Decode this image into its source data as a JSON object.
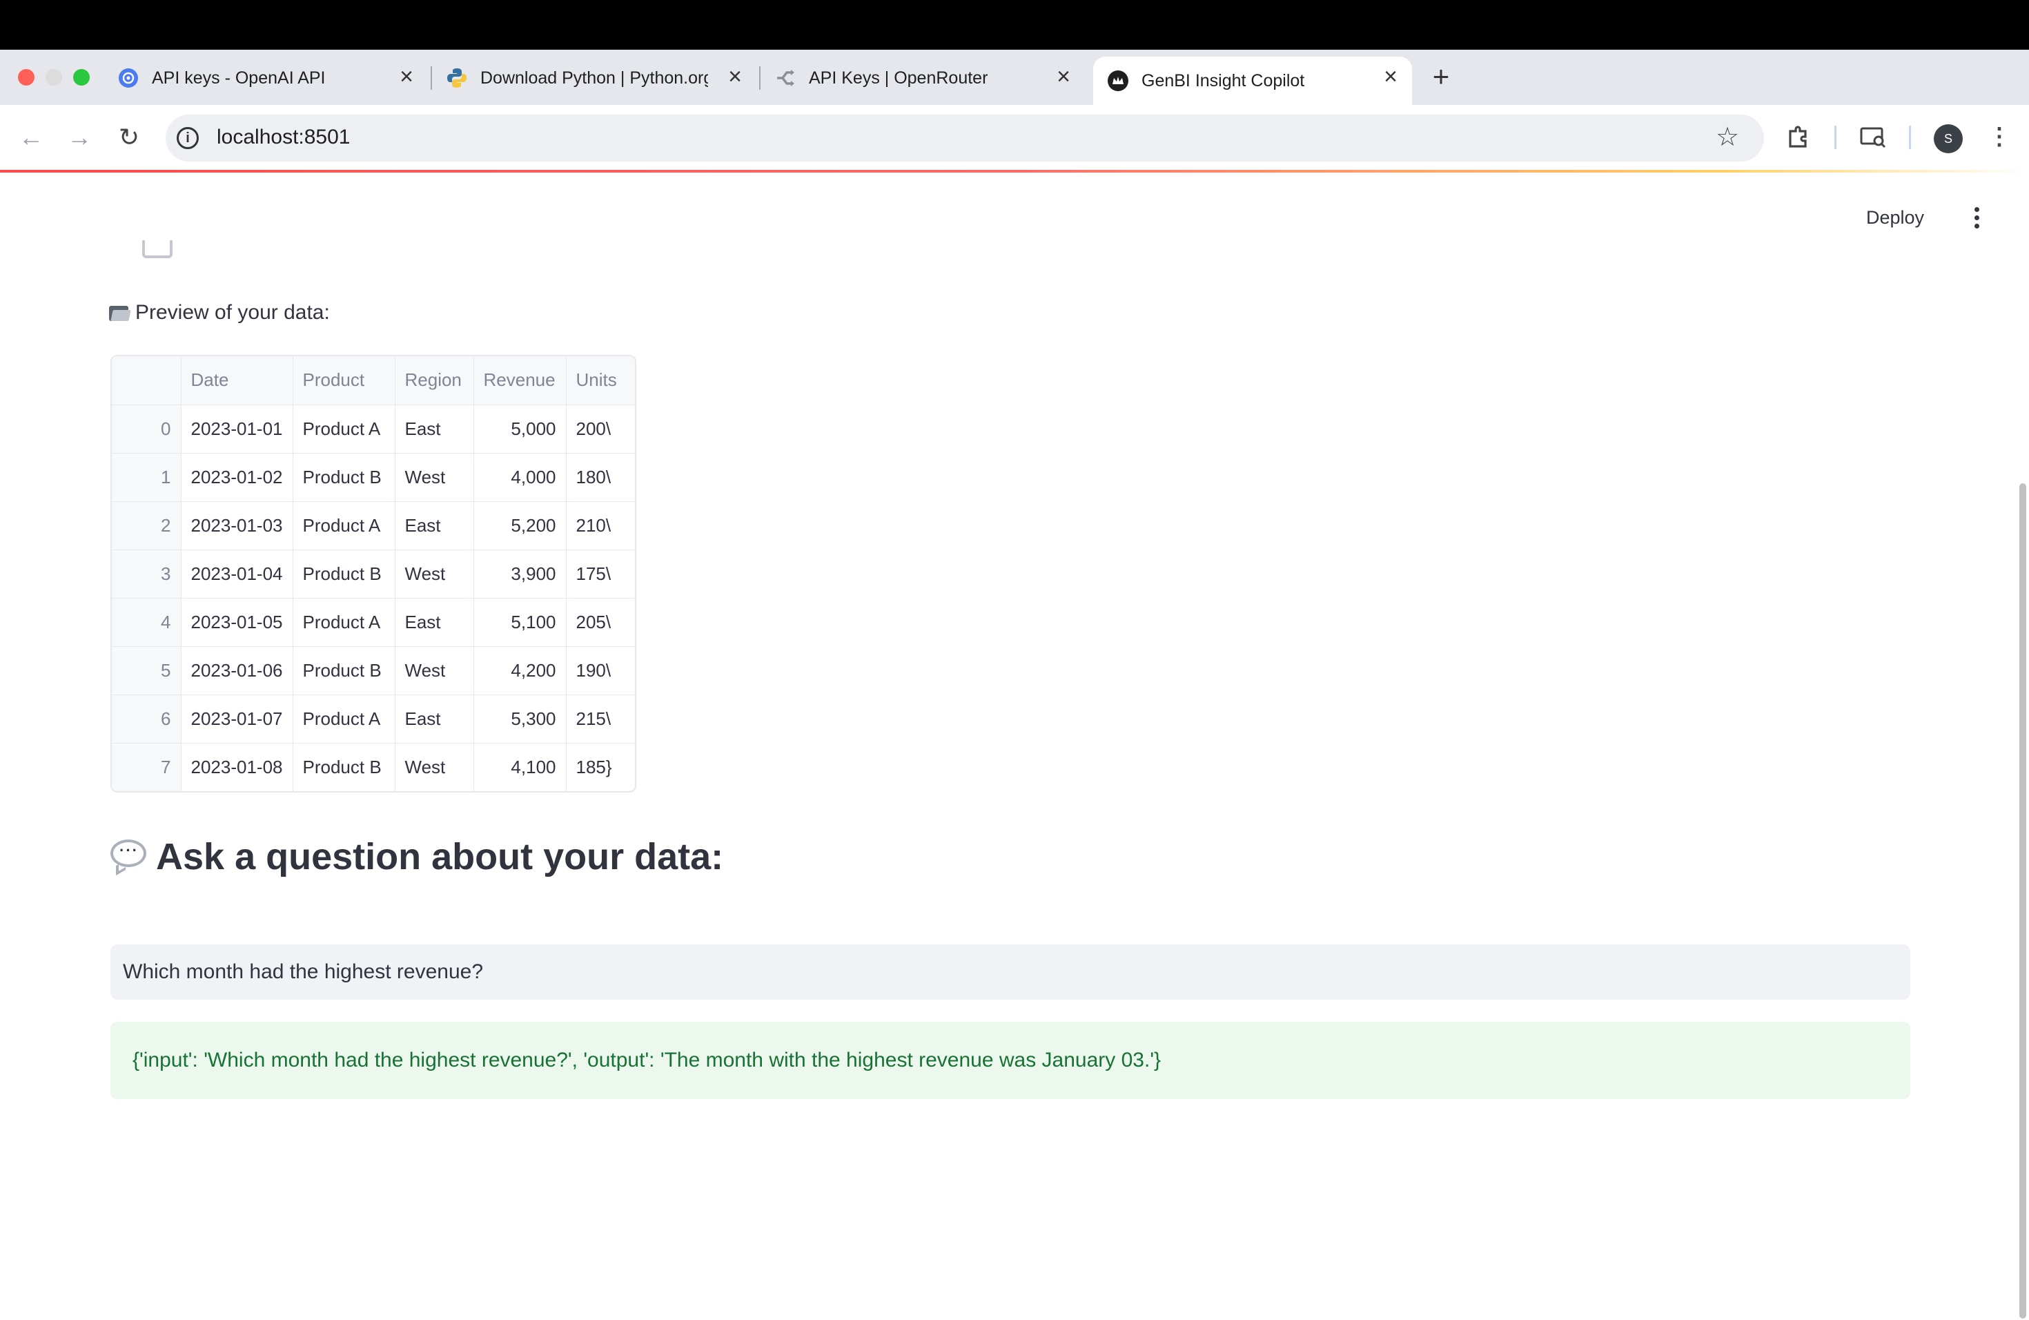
{
  "browser": {
    "tabs": [
      {
        "label": "API keys - OpenAI API",
        "icon": "openai-icon"
      },
      {
        "label": "Download Python | Python.org",
        "icon": "python-icon"
      },
      {
        "label": "API Keys | OpenRouter",
        "icon": "openrouter-icon"
      },
      {
        "label": "GenBI Insight Copilot",
        "icon": "streamlit-crown-icon",
        "active": true
      }
    ],
    "new_tab_label": "+",
    "url": "localhost:8501",
    "profile_initial": "S"
  },
  "app": {
    "deploy_label": "Deploy",
    "preview_label": "Preview of your data:",
    "table": {
      "columns": [
        "",
        "Date",
        "Product",
        "Region",
        "Revenue",
        "Units"
      ],
      "rows": [
        [
          "0",
          "2023-01-01",
          "Product A",
          "East",
          "5,000",
          "200\\"
        ],
        [
          "1",
          "2023-01-02",
          "Product B",
          "West",
          "4,000",
          "180\\"
        ],
        [
          "2",
          "2023-01-03",
          "Product A",
          "East",
          "5,200",
          "210\\"
        ],
        [
          "3",
          "2023-01-04",
          "Product B",
          "West",
          "3,900",
          "175\\"
        ],
        [
          "4",
          "2023-01-05",
          "Product A",
          "East",
          "5,100",
          "205\\"
        ],
        [
          "5",
          "2023-01-06",
          "Product B",
          "West",
          "4,200",
          "190\\"
        ],
        [
          "6",
          "2023-01-07",
          "Product A",
          "East",
          "5,300",
          "215\\"
        ],
        [
          "7",
          "2023-01-08",
          "Product B",
          "West",
          "4,100",
          "185}"
        ]
      ]
    },
    "ask_heading": "Ask a question about your data:",
    "question_value": "Which month had the highest revenue?",
    "answer_text": "{'input': 'Which month had the highest revenue?', 'output': 'The month with the highest revenue was January 03.'}"
  },
  "colors": {
    "accent": "#ff4b4b",
    "success_bg": "#ecf7ee",
    "success_text": "#177233"
  }
}
